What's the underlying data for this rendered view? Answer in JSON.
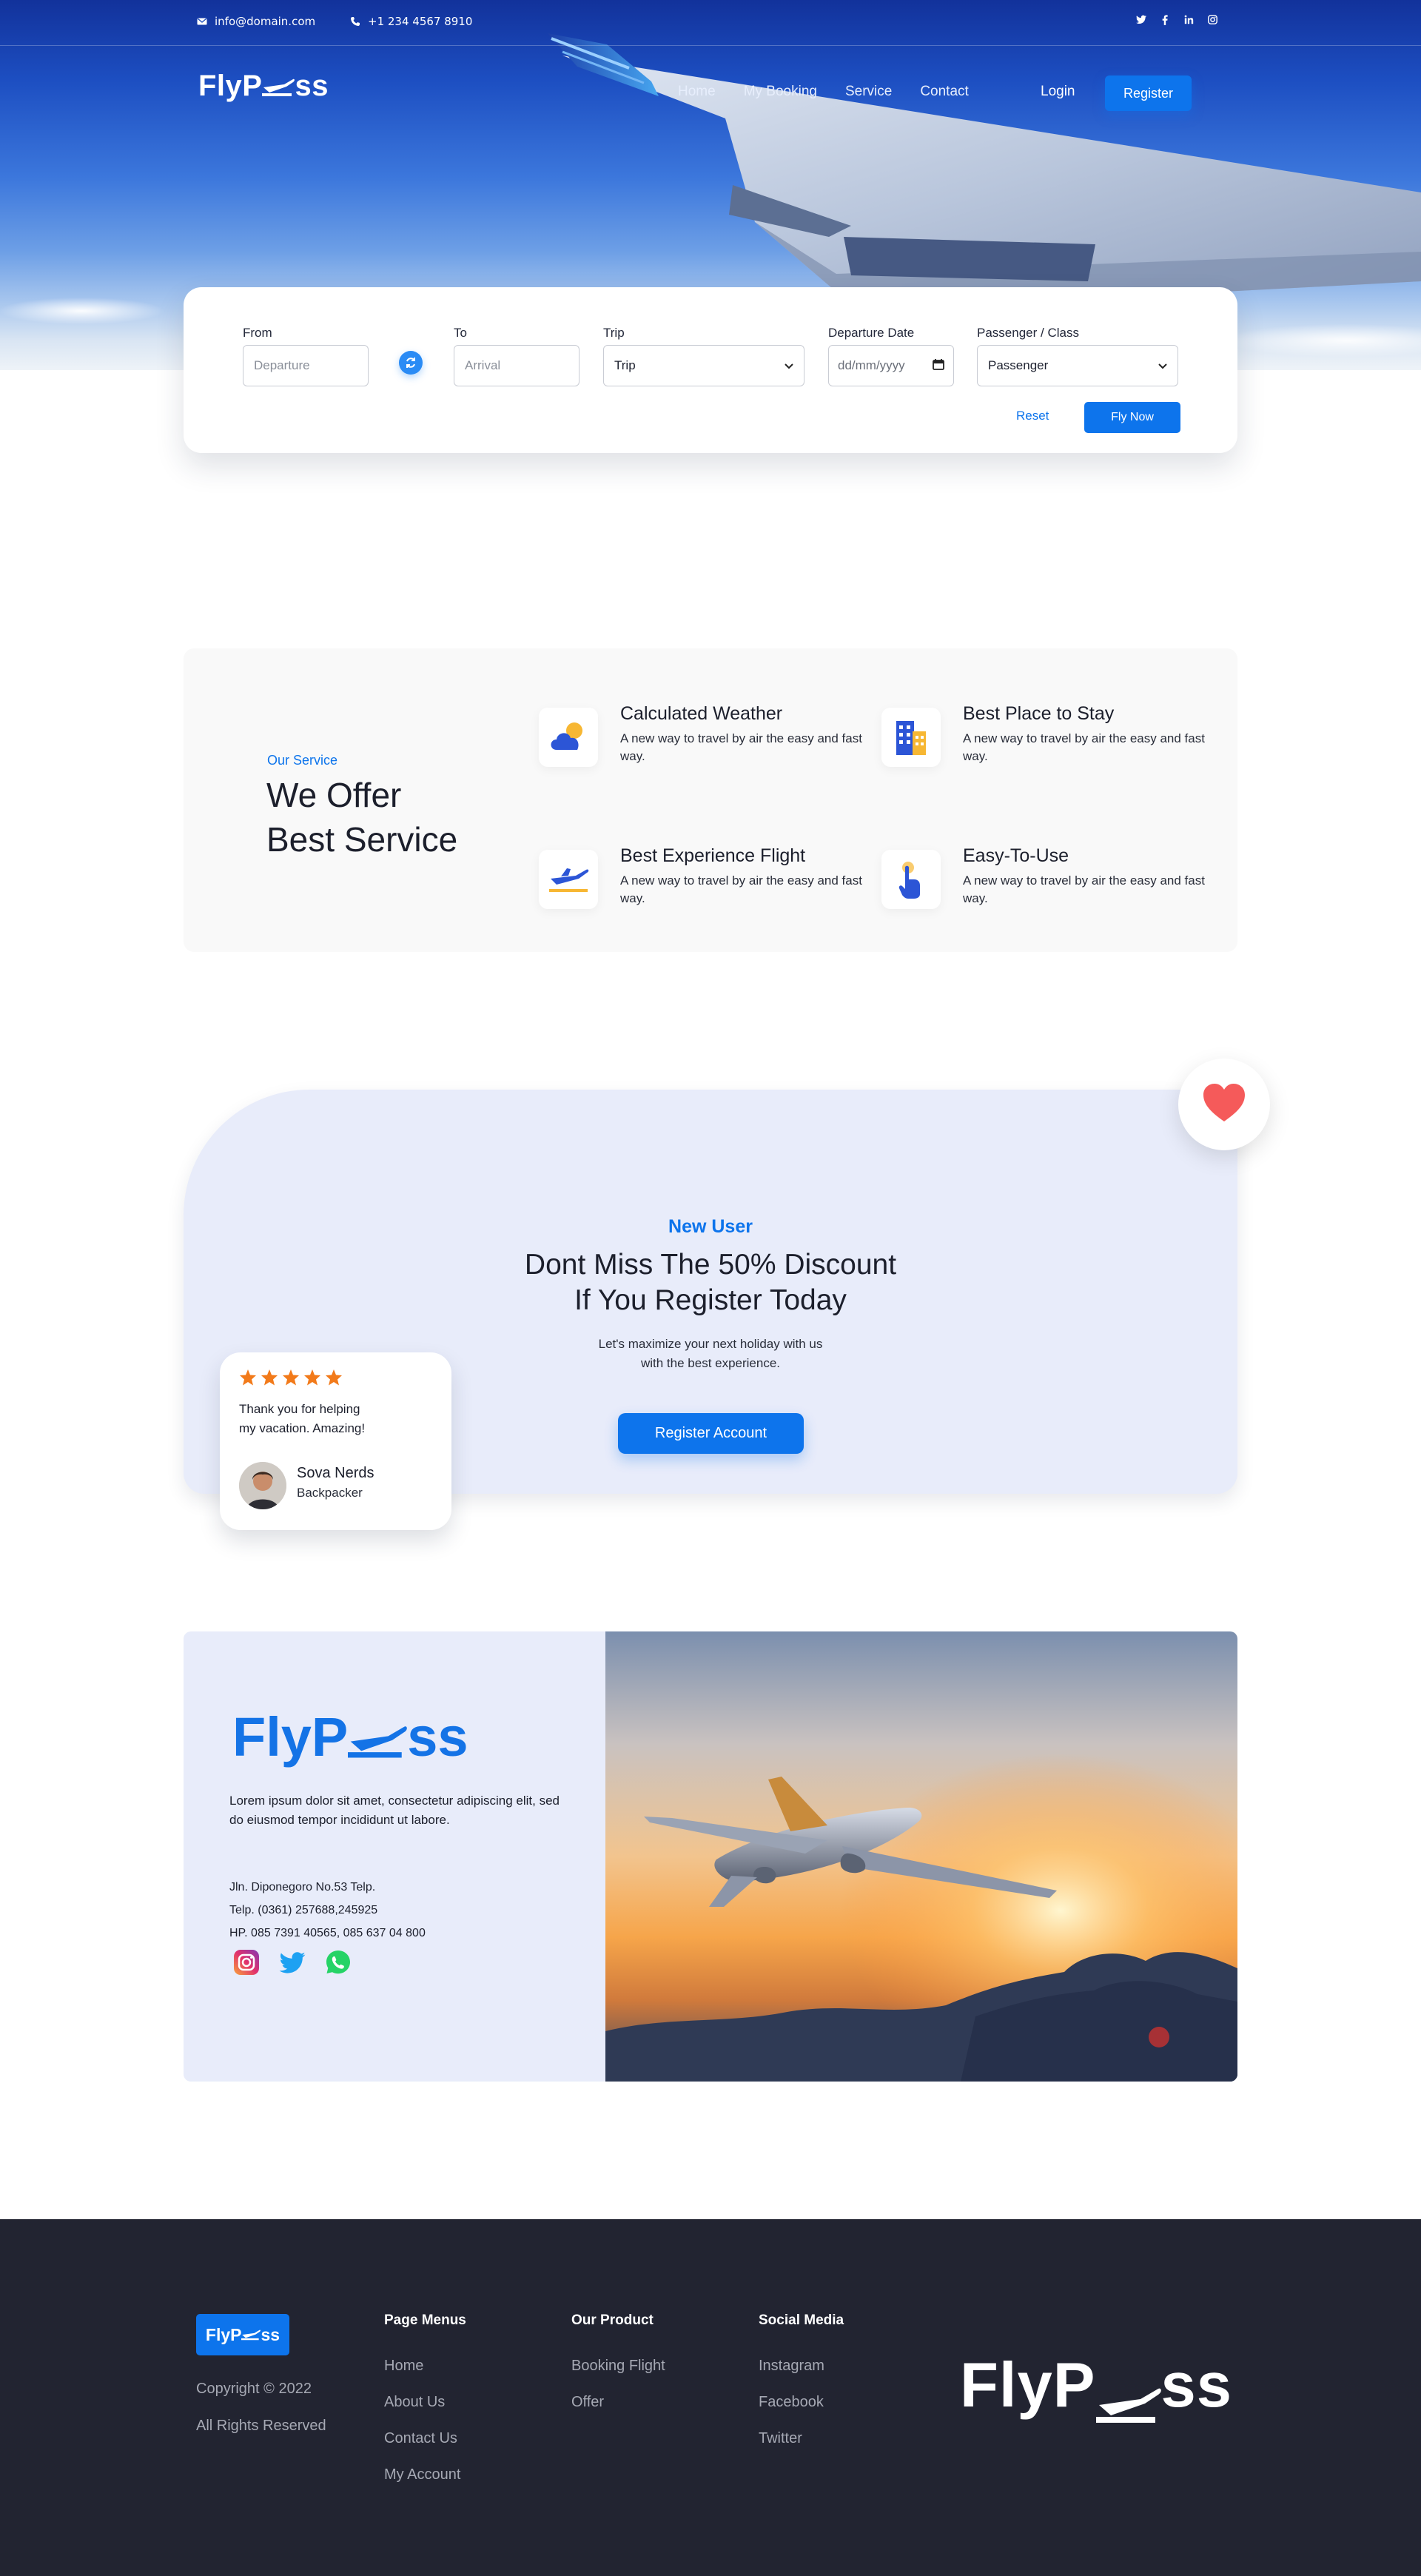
{
  "brand": {
    "name_prefix": "FlyP",
    "name_suffix": "ss",
    "primary": "#0d74ec",
    "dark": "#222431",
    "soft": "#e8ecfa"
  },
  "topbar": {
    "email": "info@domain.com",
    "phone": "+1 234 4567 8910",
    "social_icons": [
      "twitter-icon",
      "facebook-icon",
      "linkedin-icon",
      "instagram-icon"
    ]
  },
  "nav": {
    "items": [
      "Home",
      "My Booking",
      "Service",
      "Contact"
    ],
    "login": "Login",
    "register": "Register"
  },
  "search": {
    "from": {
      "label": "From",
      "placeholder": "Departure"
    },
    "to": {
      "label": "To",
      "placeholder": "Arrival"
    },
    "trip": {
      "label": "Trip",
      "value": "Trip"
    },
    "date": {
      "label": "Departure Date",
      "placeholder": "dd/mm/yyyy"
    },
    "passenger": {
      "label": "Passenger / Class",
      "value": "Passenger"
    },
    "reset": "Reset",
    "submit": "Fly Now"
  },
  "services": {
    "kicker": "Our Service",
    "title_line1": "We Offer",
    "title_line2": "Best Service",
    "items": [
      {
        "title": "Calculated Weather",
        "desc": "A new way to travel by air the easy and fast way.",
        "icon": "weather-icon"
      },
      {
        "title": "Best Place to Stay",
        "desc": "A new way to travel by air the easy and fast way.",
        "icon": "building-icon"
      },
      {
        "title": "Best Experience Flight",
        "desc": "A new way to travel by air the easy and fast way.",
        "icon": "plane-icon"
      },
      {
        "title": "Easy-To-Use",
        "desc": "A new way to travel by air the easy and fast way.",
        "icon": "tap-icon"
      }
    ]
  },
  "discount": {
    "kicker": "New User",
    "title_line1": "Dont Miss The 50% Discount",
    "title_line2": "If You Register Today",
    "sub_line1": "Let's maximize your next holiday with us",
    "sub_line2": "with the best experience.",
    "button": "Register Account"
  },
  "testimonial": {
    "rating": 5,
    "quote_line1": "Thank you for helping",
    "quote_line2": "my vacation. Amazing!",
    "name": "Sova Nerds",
    "role": "Backpacker"
  },
  "about": {
    "desc": "Lorem ipsum dolor sit amet, consectetur adipiscing elit, sed do eiusmod tempor incididunt ut labore.",
    "address": "Jln. Diponegoro No.53 Telp.",
    "telp": "Telp. (0361) 257688,245925",
    "hp": "HP. 085 7391 40565, 085 637 04 800",
    "social_icons": [
      "instagram-icon",
      "twitter-icon",
      "whatsapp-icon"
    ]
  },
  "footer": {
    "copyright": "Copyright © 2022",
    "rights": "All Rights Reserved",
    "columns": [
      {
        "title": "Page Menus",
        "links": [
          "Home",
          "About Us",
          "Contact Us",
          "My Account"
        ]
      },
      {
        "title": "Our Product",
        "links": [
          "Booking Flight",
          "Offer"
        ]
      },
      {
        "title": "Social Media",
        "links": [
          "Instagram",
          "Facebook",
          "Twitter"
        ]
      }
    ]
  }
}
